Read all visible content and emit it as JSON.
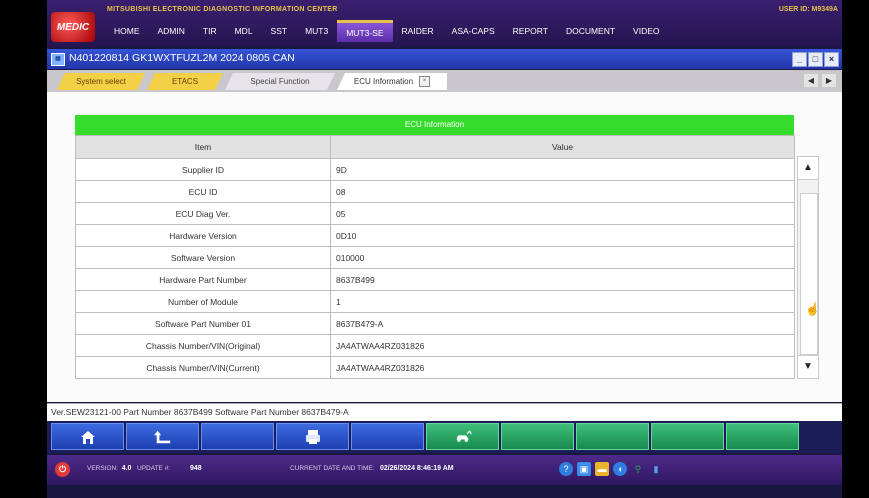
{
  "header": {
    "brand_line": "MITSUBISHI ELECTRONIC DIAGNOSTIC INFORMATION CENTER",
    "logo_text": "MEDIC",
    "user_id": "USER ID:   M9349A",
    "menu": [
      "HOME",
      "ADMIN",
      "TIR",
      "MDL",
      "SST",
      "MUT3",
      "MUT3-SE",
      "RAIDER",
      "ASA-CAPS",
      "REPORT",
      "DOCUMENT",
      "VIDEO"
    ],
    "active_menu": "MUT3-SE"
  },
  "window": {
    "title": "N401220814  GK1WXTFUZL2M 2024    0805 CAN",
    "controls": [
      "_",
      "□",
      "×"
    ]
  },
  "tabs": [
    {
      "label": "System select"
    },
    {
      "label": "ETACS"
    },
    {
      "label": "Special Function"
    },
    {
      "label": "ECU Information"
    }
  ],
  "ecu": {
    "section_title": "ECU Information",
    "columns": [
      "Item",
      "Value"
    ],
    "rows": [
      {
        "item": "Supplier ID",
        "value": "9D"
      },
      {
        "item": "ECU ID",
        "value": "08"
      },
      {
        "item": "ECU Diag Ver.",
        "value": "05"
      },
      {
        "item": "Hardware Version",
        "value": "0D10"
      },
      {
        "item": "Software Version",
        "value": "010000"
      },
      {
        "item": "Hardware Part Number",
        "value": "8637B499"
      },
      {
        "item": "Number of Module",
        "value": "1"
      },
      {
        "item": "Software Part Number 01",
        "value": "8637B479-A"
      },
      {
        "item": "Chassis Number/VIN(Original)",
        "value": "JA4ATWAA4RZ031826"
      },
      {
        "item": "Chassis Number/VIN(Current)",
        "value": "JA4ATWAA4RZ031826"
      }
    ]
  },
  "status_line": "Ver.SEW23121-00 Part Number 8637B499   Software Part Number 8637B479-A",
  "toolbar": {
    "buttons": [
      "home-icon",
      "back-arrow-icon",
      "",
      "print-icon",
      "",
      "car-connect-icon",
      "",
      "",
      "",
      ""
    ]
  },
  "taskbar": {
    "version_label": "VERSION:",
    "version_value": "4.0",
    "update_label": "UPDATE #:",
    "update_value": "948",
    "datetime_label": "CURRENT DATE AND TIME:",
    "datetime_value": "02/26/2024 8:46:19 AM"
  }
}
